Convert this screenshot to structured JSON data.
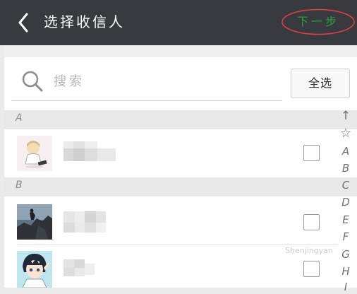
{
  "header": {
    "title": "选择收信人",
    "next_label": "下一步"
  },
  "search": {
    "placeholder": "搜索",
    "value": ""
  },
  "select_all_label": "全选",
  "sections": [
    {
      "letter": "A",
      "contacts": [
        {
          "name": "",
          "avatar": "girl-drawing-avatar",
          "checked": false
        }
      ]
    },
    {
      "letter": "B",
      "contacts": [
        {
          "name": "",
          "avatar": "rock-climber-avatar",
          "checked": false
        },
        {
          "name": "",
          "avatar": "anime-boy-avatar",
          "checked": false
        }
      ]
    }
  ],
  "index": [
    "↑",
    "☆",
    "A",
    "B",
    "C",
    "D",
    "E",
    "F",
    "G",
    "H",
    "I"
  ],
  "watermark": "Shenjingyan",
  "colors": {
    "topbar": "#393a3f",
    "next": "#2f9e37",
    "ring": "#e04040"
  }
}
